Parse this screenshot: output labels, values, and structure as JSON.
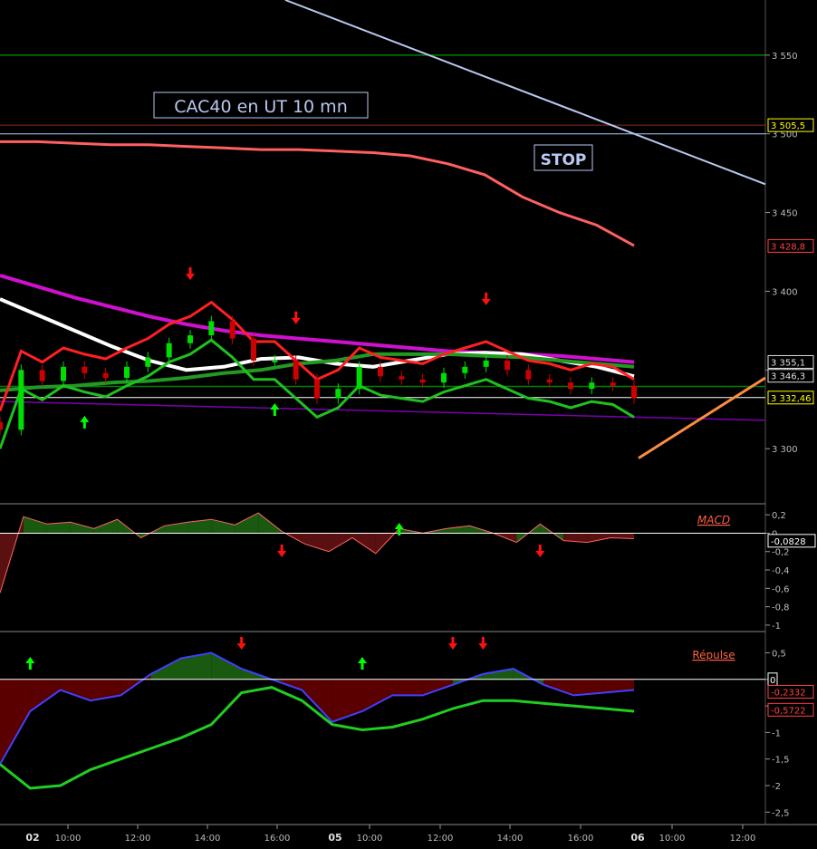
{
  "title": "CAC40 en UT 10 mn",
  "stop_label": "STOP",
  "colors": {
    "background": "#000000",
    "bull": "#00dd00",
    "bear": "#cc0000",
    "trendline": "#b8c8f0",
    "stop_line": "#ff6060",
    "support": "#008000",
    "orange": "#ff8c40",
    "magenta": "#d010d0",
    "white": "#ffffff",
    "purple": "#7a00b0"
  },
  "chart_data": [
    {
      "type": "candlestick",
      "panel": "price",
      "y_ticks": [
        "3 550",
        "3 500",
        "3 450",
        "3 400",
        "3 350",
        "3 300"
      ],
      "y_tick_values": [
        3550,
        3500,
        3450,
        3400,
        3350,
        3300
      ],
      "ylim": [
        3265,
        3585
      ],
      "x_dates": [
        "02",
        "05",
        "06"
      ],
      "x_times": [
        "10:00",
        "12:00",
        "14:00",
        "16:00",
        "10:00",
        "12:00",
        "14:00",
        "16:00",
        "10:00",
        "12:00"
      ],
      "horizontal_levels": [
        {
          "value": 3550,
          "color": "green"
        },
        {
          "value": 3505.5,
          "color": "brown"
        },
        {
          "value": 3500,
          "color": "lightblue"
        },
        {
          "value": 3339.5,
          "color": "green"
        },
        {
          "value": 3332.46,
          "color": "white"
        }
      ],
      "value_labels": [
        {
          "text": "3 505,5",
          "value": 3505.5,
          "color": "#ffff00"
        },
        {
          "text": "3 428,8",
          "value": 3428.8,
          "color": "#ff4040"
        },
        {
          "text": "3 355,1",
          "value": 3355.1,
          "color": "#e0e0e0"
        },
        {
          "text": "3 346,3",
          "value": 3346.3,
          "color": "#e0e0e0"
        },
        {
          "text": "3 332,46",
          "value": 3332.46,
          "color": "#ffff00"
        }
      ],
      "stop_line": [
        3495,
        3495,
        3494,
        3493,
        3493,
        3492,
        3491,
        3490,
        3490,
        3489,
        3488,
        3486,
        3481,
        3474,
        3460,
        3450,
        3442,
        3429
      ],
      "magenta_ma": [
        3410,
        3403,
        3396,
        3390,
        3384,
        3379,
        3375,
        3372,
        3370,
        3368,
        3366,
        3364,
        3362,
        3361,
        3360,
        3359,
        3357,
        3355
      ],
      "white_ma": [
        3395,
        3385,
        3375,
        3365,
        3356,
        3350,
        3352,
        3357,
        3358,
        3354,
        3352,
        3356,
        3360,
        3361,
        3360,
        3356,
        3352,
        3346
      ],
      "green_ma": [
        3337,
        3339,
        3340,
        3342,
        3343,
        3345,
        3348,
        3350,
        3354,
        3356,
        3360,
        3360,
        3360,
        3359,
        3358,
        3356,
        3354,
        3352
      ],
      "closes": [
        3312,
        3350,
        3343,
        3352,
        3348,
        3345,
        3352,
        3358,
        3367,
        3372,
        3381,
        3370,
        3356,
        3356,
        3344,
        3332,
        3338,
        3352,
        3346,
        3344,
        3342,
        3348,
        3352,
        3356,
        3350,
        3344,
        3342,
        3338,
        3342,
        3340,
        3332
      ],
      "arrows": [
        {
          "dir": "down",
          "index": 9
        },
        {
          "dir": "up",
          "index": 4
        },
        {
          "dir": "down",
          "index": 14
        },
        {
          "dir": "up",
          "index": 13
        },
        {
          "dir": "down",
          "index": 23
        }
      ]
    },
    {
      "type": "area",
      "panel": "macd",
      "label": "MACD",
      "y_ticks": [
        "0,2",
        "0",
        "-0,2",
        "-0,4",
        "-0,6",
        "-0,8",
        "-1"
      ],
      "y_tick_values": [
        0.2,
        0,
        -0.2,
        -0.4,
        -0.6,
        -0.8,
        -1
      ],
      "ylim": [
        -1.05,
        0.3
      ],
      "current_value": "-0,0828",
      "values": [
        -0.65,
        0.18,
        0.1,
        0.12,
        0.05,
        0.15,
        -0.05,
        0.08,
        0.12,
        0.15,
        0.09,
        0.22,
        0.02,
        -0.12,
        -0.2,
        -0.05,
        -0.22,
        0.05,
        0.0,
        0.05,
        0.08,
        0.0,
        -0.1,
        0.1,
        -0.08,
        -0.1,
        -0.05,
        -0.06
      ],
      "arrows": [
        {
          "dir": "down",
          "index": 12
        },
        {
          "dir": "up",
          "index": 17
        },
        {
          "dir": "down",
          "index": 23
        }
      ]
    },
    {
      "type": "area",
      "panel": "repulse",
      "label": "Répulse",
      "y_ticks": [
        "0,5",
        "0",
        "-0,5",
        "-1",
        "-1,5",
        "-2",
        "-2,5"
      ],
      "y_tick_values": [
        0.5,
        0,
        -0.5,
        -1,
        -1.5,
        -2,
        -2.5
      ],
      "ylim": [
        -2.7,
        0.85
      ],
      "current_values": [
        "-0,2332",
        "-0,5722"
      ],
      "fast": [
        -1.6,
        -0.6,
        -0.2,
        -0.4,
        -0.3,
        0.1,
        0.4,
        0.5,
        0.2,
        0.0,
        -0.2,
        -0.8,
        -0.6,
        -0.3,
        -0.3,
        -0.1,
        0.1,
        0.2,
        -0.1,
        -0.3,
        -0.25,
        -0.2
      ],
      "slow": [
        -1.6,
        -2.05,
        -2.0,
        -1.7,
        -1.5,
        -1.3,
        -1.1,
        -0.85,
        -0.25,
        -0.15,
        -0.4,
        -0.85,
        -0.95,
        -0.9,
        -0.75,
        -0.55,
        -0.4,
        -0.4,
        -0.45,
        -0.5,
        -0.55,
        -0.6
      ],
      "arrows": [
        {
          "dir": "up",
          "index": 1
        },
        {
          "dir": "down",
          "index": 8
        },
        {
          "dir": "up",
          "index": 12
        },
        {
          "dir": "down",
          "index": 15
        },
        {
          "dir": "down",
          "index": 16
        }
      ]
    }
  ]
}
